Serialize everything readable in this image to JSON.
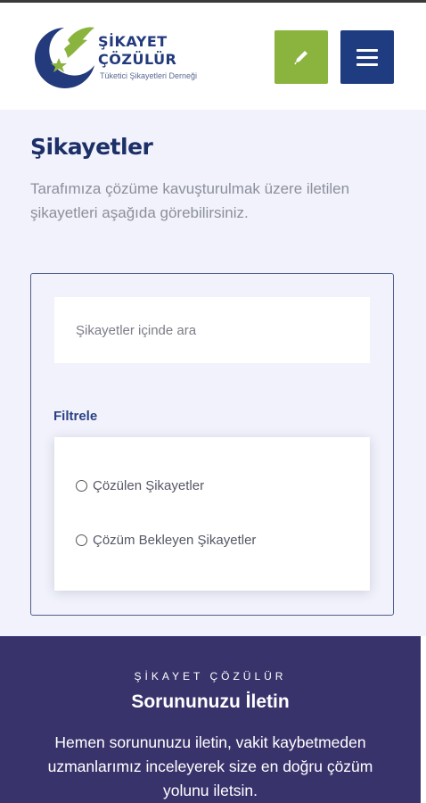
{
  "header": {
    "brand_line1": "ŞİKAYET",
    "brand_line2": "ÇÖZÜLÜR",
    "brand_tagline": "Tüketici Şikayetleri Derneği",
    "edit_icon": "pen-icon",
    "menu_icon": "hamburger-menu-icon",
    "colors": {
      "edit_button": "#8ab43d",
      "menu_button": "#1f3c80"
    }
  },
  "main": {
    "title": "Şikayetler",
    "description": "Tarafımıza çözüme kavuşturulmak üzere iletilen şikayetleri aşağıda görebilirsiniz."
  },
  "search": {
    "placeholder": "Şikayetler içinde ara",
    "value": ""
  },
  "filter": {
    "label": "Filtrele",
    "options": [
      {
        "label": "Çözülen Şikayetler",
        "selected": false
      },
      {
        "label": "Çözüm Bekleyen Şikayetler",
        "selected": false
      }
    ]
  },
  "cta": {
    "kicker": "ŞİKAYET ÇÖZÜLÜR",
    "title": "Sorununuzu İletin",
    "text": "Hemen sorununuzu iletin, vakit kaybetmeden uzmanlarımız inceleyerek size en doğru çözüm yolunu iletsin.",
    "background": "#39336c"
  }
}
